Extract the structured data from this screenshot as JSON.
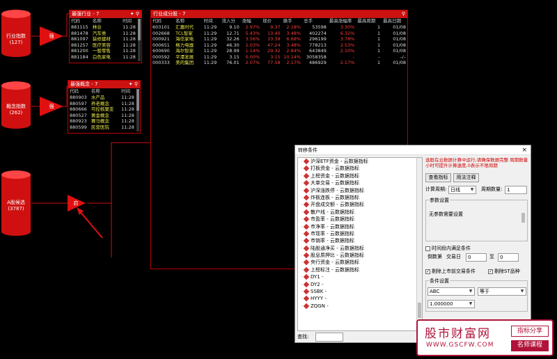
{
  "nodes": {
    "industry_src": {
      "label": "行业指数",
      "count": "(127)"
    },
    "concept_src": {
      "label": "概念指数",
      "count": "(262)"
    },
    "a_stock_src": {
      "label": "A股候选",
      "count": "(3787)"
    },
    "gate1": "强",
    "gate2": "强",
    "gate3": "启"
  },
  "panel_industry": {
    "title": "最强行业 - 7",
    "icons": "✦ ⚲",
    "headers": [
      "代码",
      "名称",
      "时间"
    ],
    "rows": [
      [
        "881115",
        "林业",
        "11:28"
      ],
      [
        "881478",
        "汽车类",
        "11:28"
      ],
      [
        "881097",
        "装修建材",
        "11:28"
      ],
      [
        "881257",
        "医疗美容",
        "11:28"
      ],
      [
        "881200",
        "一般零售",
        "11:28"
      ],
      [
        "881184",
        "白色家电",
        "11:28"
      ]
    ]
  },
  "panel_concept": {
    "title": "最强概念 - 7",
    "icons": "✦ ⚲",
    "headers": [
      "代码",
      "名称",
      "时间"
    ],
    "rows": [
      [
        "880903",
        "水产品",
        "11:28"
      ],
      [
        "880597",
        "养老概念",
        "11:28"
      ],
      [
        "880666",
        "可控核聚变",
        "11:28"
      ],
      [
        "880527",
        "黄金概念",
        "11:28"
      ],
      [
        "880923",
        "赛马概念",
        "11:28"
      ],
      [
        "880599",
        "民营医院",
        "11:28"
      ]
    ]
  },
  "panel_stocks": {
    "title": "行业成分股 - 7",
    "icon": "⚲",
    "headers": [
      "代码",
      "名称",
      "时间",
      "流入分",
      "涨幅",
      "现价",
      "换手",
      "总手",
      "最高涨幅率",
      "最高周期",
      "最高日期"
    ],
    "rows": [
      [
        "603101",
        "汇嘉时代",
        "11:29",
        "9.10",
        "2.97%",
        "9.37",
        "2.18%",
        "53598",
        "3.30%",
        "1",
        "01/08"
      ],
      [
        "002668",
        "TCL智家",
        "11:29",
        "12.71",
        "5.43%",
        "13.40",
        "3.48%",
        "402274",
        "6.32%",
        "1",
        "01/08"
      ],
      [
        "000921",
        "海信家电",
        "11:29",
        "32.26",
        "3.56%",
        "33.39",
        "6.68%",
        "296199",
        "3.78%",
        "1",
        "01/08"
      ],
      [
        "000651",
        "格力电器",
        "11:29",
        "46.30",
        "2.03%",
        "47.24",
        "3.48%",
        "778213",
        "2.53%",
        "1",
        "01/08"
      ],
      [
        "600690",
        "海尔智家",
        "11:29",
        "28.99",
        "1.14%",
        "29.32",
        "2.84%",
        "643849",
        "2.10%",
        "1",
        "01/08"
      ],
      [
        "000592",
        "平潭发展",
        "11:29",
        "3.15",
        "0.00%",
        "3.15",
        "10.14%",
        "3058358",
        "–",
        "–",
        "–/–"
      ],
      [
        "000333",
        "美的集团",
        "11:29",
        "76.01",
        "2.07%",
        "77.58",
        "2.17%",
        "486929",
        "2.17%",
        "1",
        "01/08"
      ]
    ]
  },
  "dialog": {
    "title": "转移条件",
    "close": "×",
    "tree_items": [
      "沪深ETF资金 - 云数据指标",
      "打板资金 - 云数据指标",
      "上榜资金 - 云数据指标",
      "大单交易 - 云数据指标",
      "沪深涨跌停 - 云数据指标",
      "炸板连板 - 云数据指标",
      "开盘成交额 - 云数据指标",
      "散户线 - 云数据指标",
      "市盈率 - 云数据指标",
      "市净率 - 云数据指标",
      "市现率 - 云数据指标",
      "市销率 - 云数据指标",
      "陆股通净买 - 云数据指标",
      "股息质押比 - 云数据指标",
      "央行资金 - 云数据指标",
      "上榜标注 - 云数据指标",
      "DY1 -",
      "DY2 -",
      "SSBK -",
      "HYYY -",
      "ZQGN -"
    ],
    "find_label": "查找:",
    "note": "选股在云数据计算中运行,请确保数据完整 周期数量小时可提升计算速度,0表示不限周期",
    "view_formula_btn": "查看指标",
    "usage_btn": "用法注释",
    "period_label": "计算周期:",
    "period_value": "日线",
    "count_label": "周期数量:",
    "count_value": "1",
    "params_title": "参数设置",
    "params_text": "无参数需要设置",
    "time_range_label": "时间段内满足条件",
    "recent_label": "倒数第",
    "recent_mid": "交易日",
    "recent_from": "0",
    "recent_to_label": "至",
    "recent_to": "0",
    "exclude_unlisted": "剔除上市前交易条件",
    "exclude_st": "剔除ST品种",
    "cond_title": "条件设置",
    "cond_var": "ABC",
    "cond_op": "等于",
    "cond_val": "1.000000"
  },
  "watermark": {
    "name": "股市财富网",
    "url": "WWW.GSCFW.COM",
    "tag1": "指标分享",
    "tag2": "名师课程"
  },
  "colors": {
    "accent": "#cc1111",
    "up": "#ff3b3b",
    "brand": "#b0123a"
  }
}
